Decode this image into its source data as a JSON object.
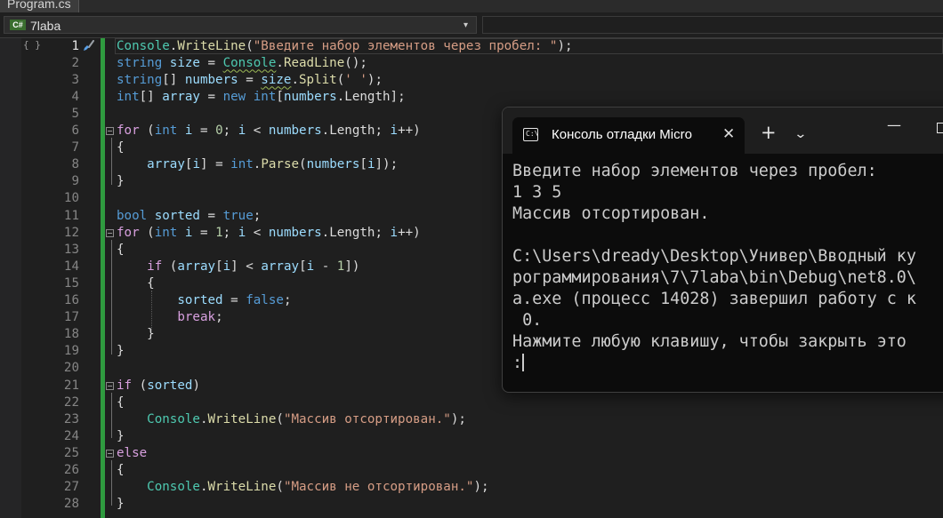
{
  "tab": {
    "file_name": "Program.cs",
    "close_glyph": "×"
  },
  "nav": {
    "badge": "C#",
    "project": "7laba",
    "arrow": "▾"
  },
  "margin_glyph": "{ }",
  "editor": {
    "active_line": 1,
    "lines": [
      {
        "n": "1",
        "tokens": [
          [
            "ty",
            "Console"
          ],
          [
            "p",
            "."
          ],
          [
            "mt",
            "WriteLine"
          ],
          [
            "p",
            "("
          ],
          [
            "str",
            "\"Введите набор элементов через пробел: \""
          ],
          [
            "p",
            ");"
          ]
        ]
      },
      {
        "n": "2",
        "tokens": [
          [
            "kw",
            "string"
          ],
          [
            "p",
            " "
          ],
          [
            "vr",
            "size"
          ],
          [
            "p",
            " = "
          ],
          [
            "tys",
            "Console"
          ],
          [
            "p",
            "."
          ],
          [
            "mt",
            "ReadLine"
          ],
          [
            "p",
            "();"
          ]
        ]
      },
      {
        "n": "3",
        "tokens": [
          [
            "kw",
            "string"
          ],
          [
            "p",
            "[] "
          ],
          [
            "vr",
            "numbers"
          ],
          [
            "p",
            " = "
          ],
          [
            "vrs",
            "size"
          ],
          [
            "p",
            "."
          ],
          [
            "mt",
            "Split"
          ],
          [
            "p",
            "("
          ],
          [
            "str",
            "' '"
          ],
          [
            "p",
            ");"
          ]
        ]
      },
      {
        "n": "4",
        "tokens": [
          [
            "kw",
            "int"
          ],
          [
            "p",
            "[] "
          ],
          [
            "vr",
            "array"
          ],
          [
            "p",
            " = "
          ],
          [
            "kw",
            "new"
          ],
          [
            "p",
            " "
          ],
          [
            "kw",
            "int"
          ],
          [
            "p",
            "["
          ],
          [
            "vr",
            "numbers"
          ],
          [
            "p",
            "."
          ],
          [
            "p",
            "Length"
          ],
          [
            "p",
            "];"
          ]
        ]
      },
      {
        "n": "5",
        "tokens": []
      },
      {
        "n": "6",
        "tokens": [
          [
            "ctl",
            "for"
          ],
          [
            "p",
            " ("
          ],
          [
            "kw",
            "int"
          ],
          [
            "p",
            " "
          ],
          [
            "vr",
            "i"
          ],
          [
            "p",
            " = "
          ],
          [
            "num",
            "0"
          ],
          [
            "p",
            "; "
          ],
          [
            "vr",
            "i"
          ],
          [
            "p",
            " < "
          ],
          [
            "vr",
            "numbers"
          ],
          [
            "p",
            ".Length; "
          ],
          [
            "vr",
            "i"
          ],
          [
            "p",
            "++)"
          ]
        ]
      },
      {
        "n": "7",
        "tokens": [
          [
            "p",
            "{"
          ]
        ]
      },
      {
        "n": "8",
        "tokens": [
          [
            "p",
            "    "
          ],
          [
            "vr",
            "array"
          ],
          [
            "p",
            "["
          ],
          [
            "vr",
            "i"
          ],
          [
            "p",
            "] = "
          ],
          [
            "kw",
            "int"
          ],
          [
            "p",
            "."
          ],
          [
            "mt",
            "Parse"
          ],
          [
            "p",
            "("
          ],
          [
            "vr",
            "numbers"
          ],
          [
            "p",
            "["
          ],
          [
            "vr",
            "i"
          ],
          [
            "p",
            "]);"
          ]
        ]
      },
      {
        "n": "9",
        "tokens": [
          [
            "p",
            "}"
          ]
        ]
      },
      {
        "n": "10",
        "tokens": []
      },
      {
        "n": "11",
        "tokens": [
          [
            "kw",
            "bool"
          ],
          [
            "p",
            " "
          ],
          [
            "vr",
            "sorted"
          ],
          [
            "p",
            " = "
          ],
          [
            "kw",
            "true"
          ],
          [
            "p",
            ";"
          ]
        ]
      },
      {
        "n": "12",
        "tokens": [
          [
            "ctl",
            "for"
          ],
          [
            "p",
            " ("
          ],
          [
            "kw",
            "int"
          ],
          [
            "p",
            " "
          ],
          [
            "vr",
            "i"
          ],
          [
            "p",
            " = "
          ],
          [
            "num",
            "1"
          ],
          [
            "p",
            "; "
          ],
          [
            "vr",
            "i"
          ],
          [
            "p",
            " < "
          ],
          [
            "vr",
            "numbers"
          ],
          [
            "p",
            ".Length; "
          ],
          [
            "vr",
            "i"
          ],
          [
            "p",
            "++)"
          ]
        ]
      },
      {
        "n": "13",
        "tokens": [
          [
            "p",
            "{"
          ]
        ]
      },
      {
        "n": "14",
        "tokens": [
          [
            "p",
            "    "
          ],
          [
            "ctl",
            "if"
          ],
          [
            "p",
            " ("
          ],
          [
            "vr",
            "array"
          ],
          [
            "p",
            "["
          ],
          [
            "vr",
            "i"
          ],
          [
            "p",
            "] < "
          ],
          [
            "vr",
            "array"
          ],
          [
            "p",
            "["
          ],
          [
            "vr",
            "i"
          ],
          [
            "p",
            " - "
          ],
          [
            "num",
            "1"
          ],
          [
            "p",
            "])"
          ]
        ]
      },
      {
        "n": "15",
        "tokens": [
          [
            "p",
            "    {"
          ]
        ]
      },
      {
        "n": "16",
        "tokens": [
          [
            "p",
            "        "
          ],
          [
            "vr",
            "sorted"
          ],
          [
            "p",
            " = "
          ],
          [
            "kw",
            "false"
          ],
          [
            "p",
            ";"
          ]
        ]
      },
      {
        "n": "17",
        "tokens": [
          [
            "p",
            "        "
          ],
          [
            "ctl",
            "break"
          ],
          [
            "p",
            ";"
          ]
        ]
      },
      {
        "n": "18",
        "tokens": [
          [
            "p",
            "    }"
          ]
        ]
      },
      {
        "n": "19",
        "tokens": [
          [
            "p",
            "}"
          ]
        ]
      },
      {
        "n": "20",
        "tokens": []
      },
      {
        "n": "21",
        "tokens": [
          [
            "ctl",
            "if"
          ],
          [
            "p",
            " ("
          ],
          [
            "vr",
            "sorted"
          ],
          [
            "p",
            ")"
          ]
        ]
      },
      {
        "n": "22",
        "tokens": [
          [
            "p",
            "{"
          ]
        ]
      },
      {
        "n": "23",
        "tokens": [
          [
            "p",
            "    "
          ],
          [
            "ty",
            "Console"
          ],
          [
            "p",
            "."
          ],
          [
            "mt",
            "WriteLine"
          ],
          [
            "p",
            "("
          ],
          [
            "str",
            "\"Массив отсортирован.\""
          ],
          [
            "p",
            ");"
          ]
        ]
      },
      {
        "n": "24",
        "tokens": [
          [
            "p",
            "}"
          ]
        ]
      },
      {
        "n": "25",
        "tokens": [
          [
            "ctl",
            "else"
          ]
        ]
      },
      {
        "n": "26",
        "tokens": [
          [
            "p",
            "{"
          ]
        ]
      },
      {
        "n": "27",
        "tokens": [
          [
            "p",
            "    "
          ],
          [
            "ty",
            "Console"
          ],
          [
            "p",
            "."
          ],
          [
            "mt",
            "WriteLine"
          ],
          [
            "p",
            "("
          ],
          [
            "str",
            "\"Массив не отсортирован.\""
          ],
          [
            "p",
            ");"
          ]
        ]
      },
      {
        "n": "28",
        "tokens": [
          [
            "p",
            "}"
          ]
        ]
      }
    ]
  },
  "console": {
    "title": "Консоль отладки Micro",
    "close_glyph": "✕",
    "plus_glyph": "+",
    "dropdown_glyph": "⌄",
    "minimize_glyph": "—",
    "output": [
      "Введите набор элементов через пробел:",
      "1 3 5",
      "Массив отсортирован.",
      "",
      "C:\\Users\\dready\\Desktop\\Универ\\Вводный ку",
      "рограммирования\\7\\7laba\\bin\\Debug\\net8.0\\",
      "a.exe (процесс 14028) завершил работу с к",
      " 0.",
      "Нажмите любую клавишу, чтобы закрыть это",
      ":"
    ]
  },
  "colors": {
    "editor_bg": "#1f1f1f",
    "keyword": "#569cd6",
    "type": "#4ec9b0",
    "string": "#d69d85",
    "method": "#dcdcaa",
    "variable": "#9cdcfe",
    "control": "#d8a0df",
    "number": "#b5cea8",
    "change_bar": "#2f9b3f",
    "console_bg": "#0c0c0c"
  }
}
